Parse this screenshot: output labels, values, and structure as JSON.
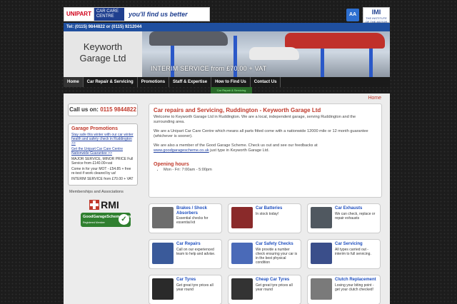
{
  "banner": {
    "unipart": "UNIPART",
    "care_centre": "CAR CARE CENTRE",
    "slogan": "you'll find us better",
    "aa": "AA",
    "imi": "IMI",
    "imi_sub": "THE INSTITUTE OF THE MOTOR INDUSTRY"
  },
  "phone_bar": "Tel: (0115) 9844822 or (0115) 9212044",
  "header": {
    "title_line1": "Keyworth",
    "title_line2": "Garage Ltd",
    "caption": "INTERIM SERVICE  from £70.00 + VAT"
  },
  "nav": {
    "items": [
      "Home",
      "Car Repair & Servicing",
      "Promotions",
      "Staff & Expertise",
      "How to Find Us",
      "Contact Us"
    ],
    "sub": "Car Repair & Servicing"
  },
  "breadcrumb": "Home",
  "sidebar": {
    "call_label": "Call us on:",
    "call_number": "0115 9844822",
    "promo_title": "Garage Promotions",
    "promo_link1": "Stay safe this winter with our car winter health and safety check in Ruddington >>",
    "promo_link2": "Get the Unipart Car Care Centre Nationwide Guarantee >>",
    "promo_text1": "MAJOR SERVICE, MINOR PRICE Full Service from £140.00+vat",
    "promo_text2": "Come in for your MOT - £54.85 + free re-test if work cleared by us!",
    "promo_text3": "INTERIM SERVICE from £70.00 + VAT",
    "memberships": "Memberships and Associations",
    "rmi": "RMI",
    "ggs": "GoodGarageScheme.com",
    "ggs_sub": "Registered Member"
  },
  "content": {
    "heading": "Car repairs and Servicing, Ruddington - Keyworth Garage Ltd",
    "p1": "Welcome to Keyworth Garage Ltd in Ruddington. We are a local, independent garage, serving Ruddington and the surrounding area.",
    "p2": "We are a Unipart Car Care Centre which means all parts fitted come with a nationwide 12000 mile or 12 month guarantee (whichever is sooner).",
    "p3_pre": "We are also a member of the Good Garage Scheme. Check us out and see our feedbacks at",
    "p3_link": "www.goodgaragescheme.co.uk",
    "p3_post": " just type in Keyworth Garage Ltd.",
    "hours_title": "Opening hours",
    "hours": "Mon - Fri: 7:00am - 5:00pm"
  },
  "tiles": [
    {
      "title": "Brakes / Shock Absorbers",
      "desc": "Essential checks for essential kit",
      "color": "#6d6d6d"
    },
    {
      "title": "Car Batteries",
      "desc": "In stock today!",
      "color": "#8a2a2a"
    },
    {
      "title": "Car Exhausts",
      "desc": "We can check, replace or repair exhausts",
      "color": "#505860"
    },
    {
      "title": "Car Repairs",
      "desc": "Call on our experienced team to help and advise.",
      "color": "#3a5a9a"
    },
    {
      "title": "Car Safety Checks",
      "desc": "We provide a number check ensuring your car is in the best physical condition",
      "color": "#4a6ab8"
    },
    {
      "title": "Car Servicing",
      "desc": "All types carried out - interim to full servicing.",
      "color": "#3a4e8a"
    },
    {
      "title": "Car Tyres",
      "desc": "Get great tyre prices all year round",
      "color": "#2a2a2a"
    },
    {
      "title": "Cheap Car Tyres",
      "desc": "Get great tyre prices all year round",
      "color": "#333333"
    },
    {
      "title": "Clutch Replacement",
      "desc": "Losing your biting point - get your clutch checked!",
      "color": "#7a7a7a"
    }
  ]
}
